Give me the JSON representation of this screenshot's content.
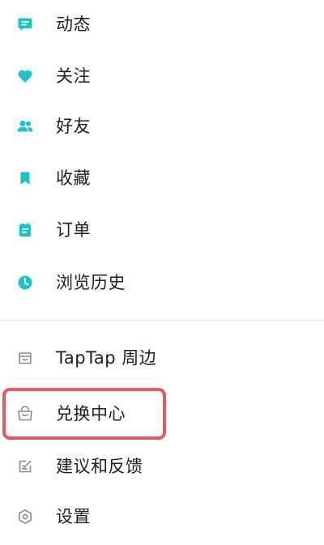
{
  "colors": {
    "accent": "#1fc2c4",
    "icon_gray": "#8a8a8a",
    "highlight": "#e8585f",
    "text": "#1e1e1e"
  },
  "menu": {
    "primary_items": [
      {
        "label": "动态",
        "icon": "post-icon"
      },
      {
        "label": "关注",
        "icon": "heart-icon"
      },
      {
        "label": "好友",
        "icon": "friends-icon"
      },
      {
        "label": "收藏",
        "icon": "bookmark-icon"
      },
      {
        "label": "订单",
        "icon": "order-icon"
      },
      {
        "label": "浏览历史",
        "icon": "clock-icon"
      }
    ],
    "secondary_items": [
      {
        "label": "TapTap 周边",
        "icon": "store-icon"
      },
      {
        "label": "兑换中心",
        "icon": "bag-icon",
        "highlighted": true
      },
      {
        "label": "建议和反馈",
        "icon": "feedback-icon"
      },
      {
        "label": "设置",
        "icon": "settings-icon"
      }
    ]
  }
}
